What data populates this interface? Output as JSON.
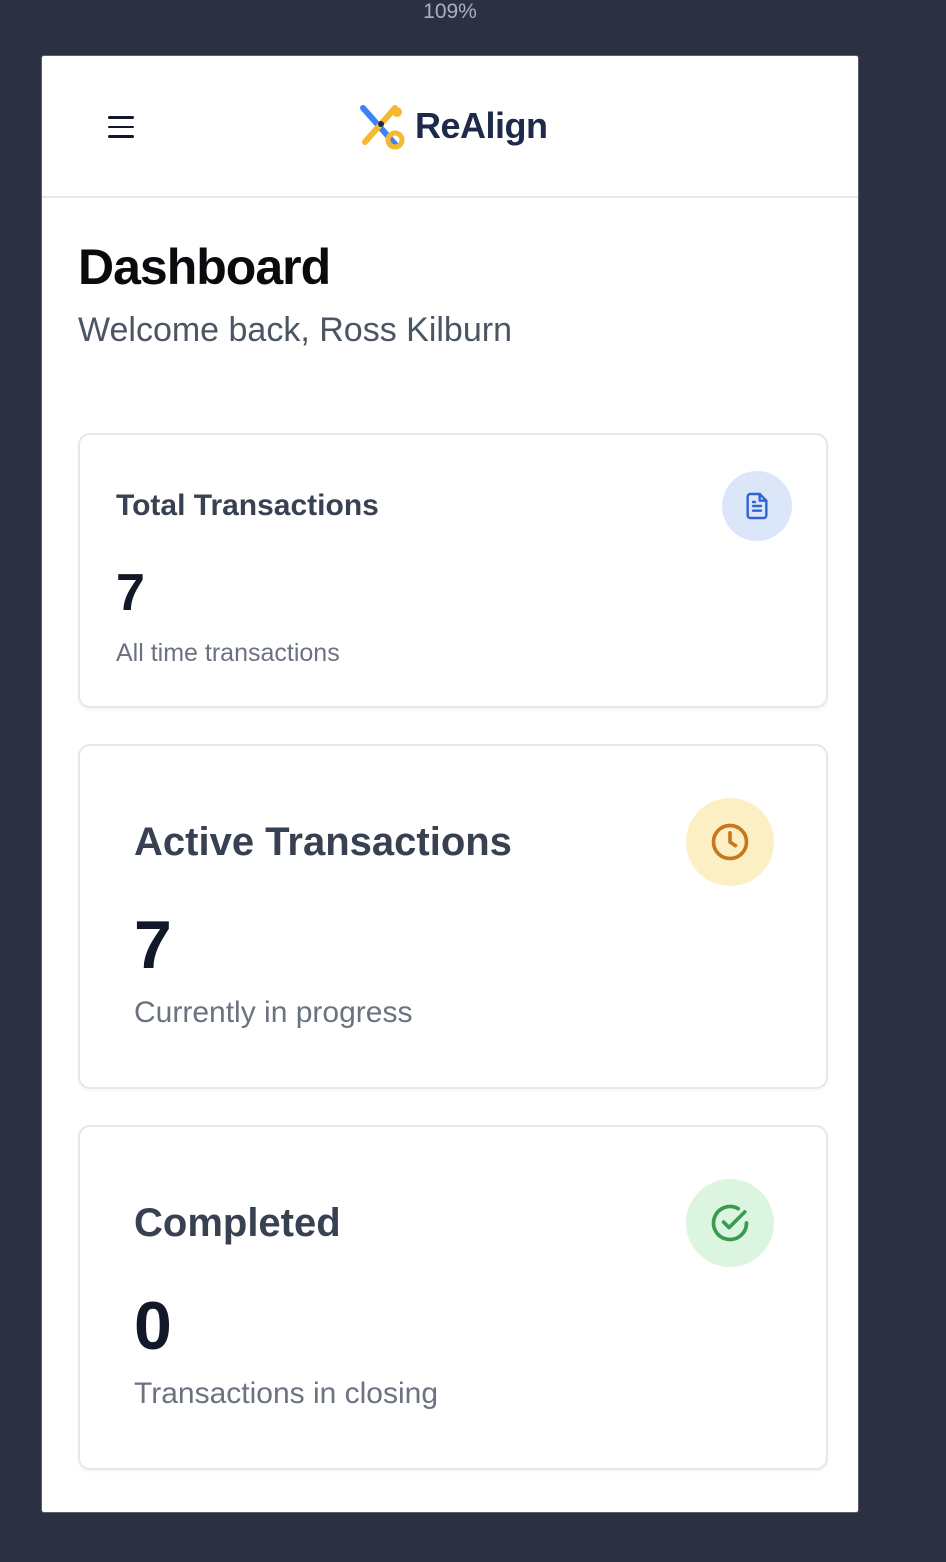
{
  "browser": {
    "zoom": "109%"
  },
  "header": {
    "brand": "ReAlign"
  },
  "page": {
    "title": "Dashboard",
    "welcome": "Welcome back, Ross Kilburn"
  },
  "stats": [
    {
      "label": "Total Transactions",
      "value": "7",
      "sub": "All time transactions",
      "icon": "document-icon",
      "color": "#2f63d6"
    },
    {
      "label": "Active Transactions",
      "value": "7",
      "sub": "Currently in progress",
      "icon": "clock-icon",
      "color": "#c7781c"
    },
    {
      "label": "Completed",
      "value": "0",
      "sub": "Transactions in closing",
      "icon": "check-circle-icon",
      "color": "#3a9a4d"
    }
  ],
  "colors": {
    "background": "#2c3142",
    "brand_text": "#1e2a4a",
    "logo_blue": "#3b82f6",
    "logo_yellow": "#f5b82e"
  }
}
